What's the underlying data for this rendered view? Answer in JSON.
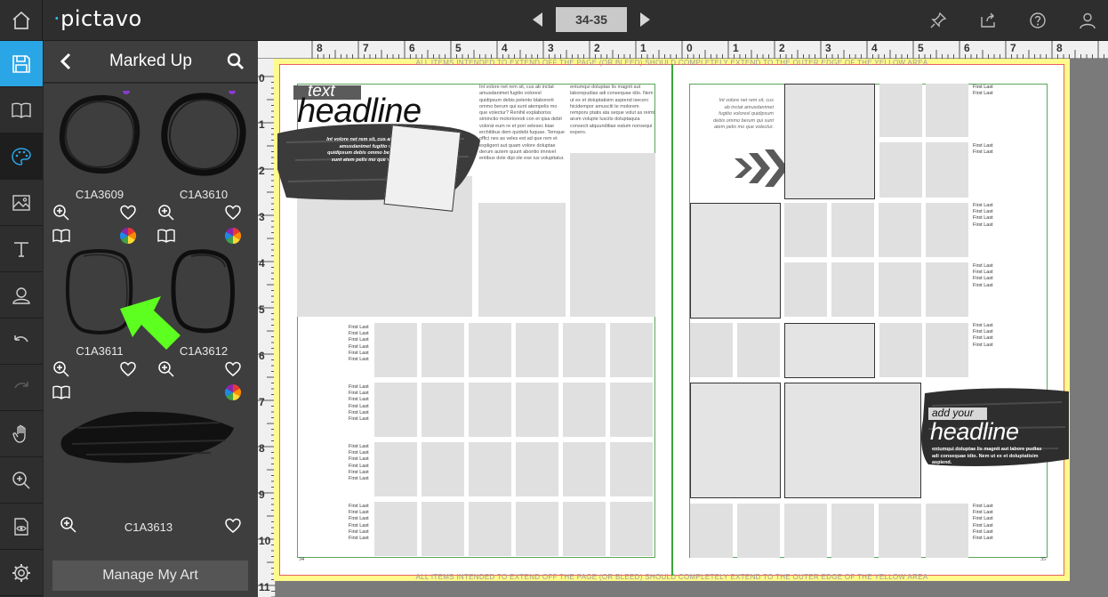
{
  "app": {
    "logo": "pictavo"
  },
  "header": {
    "page_range": "34-35"
  },
  "panel": {
    "title": "Marked Up",
    "items": [
      {
        "id": "C1A3609"
      },
      {
        "id": "C1A3610"
      },
      {
        "id": "C1A3611"
      },
      {
        "id": "C1A3612"
      },
      {
        "id": "C1A3613"
      }
    ],
    "manage_label": "Manage My Art"
  },
  "rulers": {
    "top": [
      "8",
      "7",
      "6",
      "5",
      "4",
      "3",
      "2",
      "1",
      "0",
      "1",
      "2",
      "3",
      "4",
      "5",
      "6",
      "7",
      "8"
    ],
    "left": [
      "0",
      "1",
      "2",
      "3",
      "4",
      "5",
      "6",
      "7",
      "8",
      "9",
      "10",
      "11"
    ]
  },
  "spread": {
    "bleed_note": "ALL ITEMS INTENDED TO EXTEND OFF THE PAGE (OR BLEED) SHOULD COMPLETELY EXTEND TO THE OUTER EDGE OF THE YELLOW AREA",
    "left": {
      "kicker": "text",
      "headline": "headline",
      "caption": "Int volore net rem sit, cus ab inctat amusdanimet fugitio voloresl quidipsum debis ommo berum qui sunt atem pelis mo que volectur.",
      "body_col1": "Int volore net rem sit, cus ab inctat amusdanimet fugitio voloresl quidipsum debis pelento blaborerit ommo berum qui sunt atempelis mo que volectur? Renihil explaboriss siminctio molorioresti con et qisa debit volorat eum re et pori velesec biae erchitibus dem quidebi fuquae. Temque offici nes as veles est ad que rem et expligent aut quam volore doluptae derum autem quunt aboritio imnivel entibus dole dipi ole ese ius volupitatur.",
      "body_col2": "entumqui doluptae lis magnit aut laborepudias adi consequae idio. Nem ut ex et doluptatisim aspiend isecerc hicidempor amusciti te molorem remporu ptatis ata seque volut as reimt arum volupte luscits doluptaquia consecit atquunditiae eatum nonsequi expero.",
      "name_label": "First Last",
      "page_number": "34"
    },
    "right": {
      "caption": "Int volore net rem sit, cus ab inctat amusdanimet fugitio voloresl quidipsum debis ommo berum qui sunt atem pelis mo que volectur.",
      "kicker": "add your",
      "headline": "headline",
      "deck": "entumqui doluptae lis magnit aut labore pudias adi consequae idio. Nem ut ex et doluptatisim aspiend.",
      "name_label": "First Last",
      "page_number": "35"
    }
  }
}
